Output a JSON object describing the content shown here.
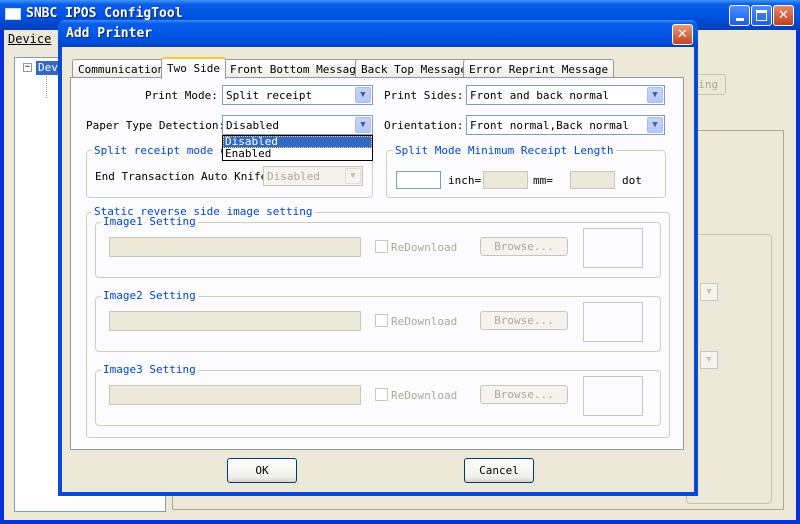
{
  "main_window": {
    "title": "SNBC IPOS ConfigTool",
    "menu": {
      "device": "Device"
    },
    "tree": {
      "root_label": "Dev"
    },
    "background_button_label": "tting"
  },
  "dialog": {
    "title": "Add Printer",
    "tabs": [
      "Communication",
      "Two Side",
      "Front Bottom Message",
      "Back Top Message",
      "Error Reprint Message"
    ],
    "active_tab": "Two Side",
    "print_mode": {
      "label": "Print Mode:",
      "value": "Split receipt"
    },
    "print_sides": {
      "label": "Print Sides:",
      "value": "Front and back normal"
    },
    "paper_type_detection": {
      "label": "Paper Type Detection:",
      "value": "Disabled",
      "options": [
        "Disabled",
        "Enabled"
      ],
      "highlighted": "Disabled"
    },
    "orientation": {
      "label": "Orientation:",
      "value": "Front normal,Back normal"
    },
    "split_cut_group": {
      "title": "Split receipt mode cut",
      "end_knife_label": "End Transaction Auto Knife:",
      "end_knife_value": "Disabled"
    },
    "split_min_length_group": {
      "title": "Split Mode Minimum Receipt Length",
      "inch_value": "",
      "inch_label": "inch=",
      "mm_value": "",
      "mm_label": "mm=",
      "dot_value": "",
      "dot_label": "dot"
    },
    "static_image_group": {
      "title": "Static reverse side image setting",
      "images": [
        {
          "title": "Image1 Setting",
          "path": "",
          "redownload_label": "ReDownload",
          "browse_label": "Browse..."
        },
        {
          "title": "Image2 Setting",
          "path": "",
          "redownload_label": "ReDownload",
          "browse_label": "Browse..."
        },
        {
          "title": "Image3 Setting",
          "path": "",
          "redownload_label": "ReDownload",
          "browse_label": "Browse..."
        }
      ]
    },
    "ok_label": "OK",
    "cancel_label": "Cancel"
  },
  "colors": {
    "titlebar_blue": "#0054e3",
    "dialog_face": "#ece9d8",
    "tab_panel": "#fcfcfe",
    "group_title_blue": "#0046d5",
    "selection_blue": "#316ac5",
    "disabled_text": "#aca899"
  },
  "icons": {
    "combo_arrow": "chevron-down-icon",
    "close": "close-icon",
    "minimize": "minimize-icon",
    "maximize": "maximize-icon",
    "app": "app-window-icon",
    "tree_expander": "tree-collapse-icon"
  }
}
